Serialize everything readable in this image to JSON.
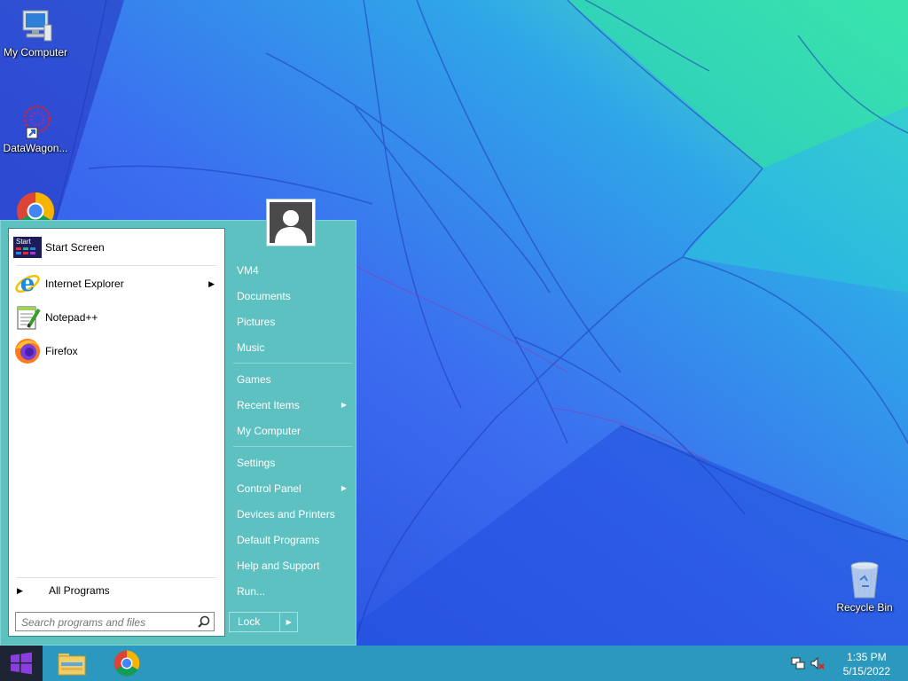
{
  "desktop": {
    "icons": [
      {
        "label": "My Computer"
      },
      {
        "label": "DataWagon..."
      },
      {
        "label": "Google Chrome"
      },
      {
        "label": "Recycle Bin"
      }
    ]
  },
  "start_menu": {
    "pinned": [
      {
        "label": "Start Screen",
        "icon": "start-screen-icon",
        "icon_text": "Start"
      },
      {
        "label": "Internet Explorer",
        "icon": "internet-explorer-icon",
        "has_submenu": true
      },
      {
        "label": "Notepad++",
        "icon": "notepad-plus-plus-icon"
      },
      {
        "label": "Firefox",
        "icon": "firefox-icon"
      }
    ],
    "all_programs_label": "All Programs",
    "search": {
      "placeholder": "Search programs and files"
    },
    "user": {
      "name": "VM4"
    },
    "right_items": [
      {
        "label": "VM4"
      },
      {
        "label": "Documents"
      },
      {
        "label": "Pictures"
      },
      {
        "label": "Music"
      },
      {
        "label": "Games"
      },
      {
        "label": "Recent Items",
        "has_submenu": true
      },
      {
        "label": "My Computer"
      },
      {
        "label": "Settings"
      },
      {
        "label": "Control Panel",
        "has_submenu": true
      },
      {
        "label": "Devices and Printers"
      },
      {
        "label": "Default Programs"
      },
      {
        "label": "Help and Support"
      },
      {
        "label": "Run..."
      }
    ],
    "power": {
      "label": "Lock"
    }
  },
  "taskbar": {
    "apps": [
      {
        "name": "File Explorer",
        "icon": "file-explorer-icon"
      },
      {
        "name": "Google Chrome",
        "icon": "chrome-icon"
      }
    ],
    "clock": {
      "time": "1:35 PM",
      "date": "5/15/2022"
    }
  },
  "colors": {
    "start_menu_bg": "#5dc1c1",
    "taskbar_bg": "#2a99bd",
    "start_button_bg": "#1d2433"
  }
}
